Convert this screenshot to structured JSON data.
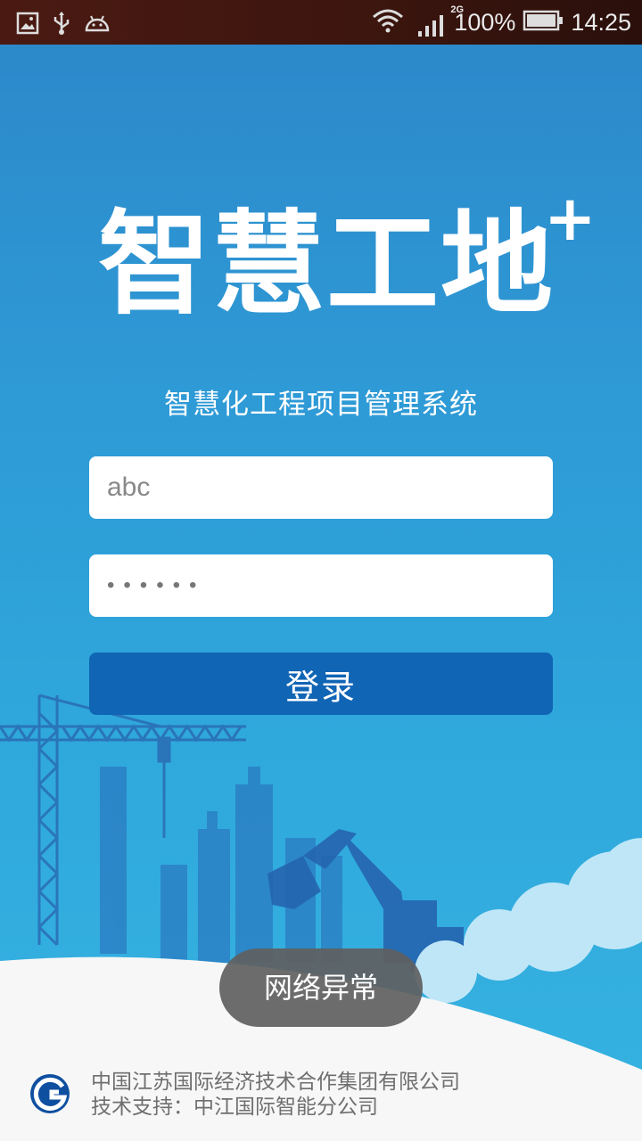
{
  "status_bar": {
    "network": "2G",
    "battery": "100%",
    "time": "14:25",
    "left_icons": [
      "image-icon",
      "usb-icon",
      "android-icon"
    ],
    "right_icons": [
      "wifi-icon",
      "signal-icon",
      "battery-icon"
    ]
  },
  "app": {
    "logo_text": "智慧工地",
    "logo_plus": "+",
    "subtitle": "智慧化工程项目管理系统"
  },
  "login": {
    "username_value": "abc",
    "password_value": "••••••",
    "button_label": "登录"
  },
  "toast": {
    "message": "网络异常"
  },
  "footer": {
    "company": "中国江苏国际经济技术合作集团有限公司",
    "support": "技术支持：中江国际智能分公司"
  },
  "colors": {
    "background_top": "#2c87c9",
    "background_bottom": "#36b3e1",
    "button": "#1065b5",
    "footer_text": "#6f6f6f"
  }
}
